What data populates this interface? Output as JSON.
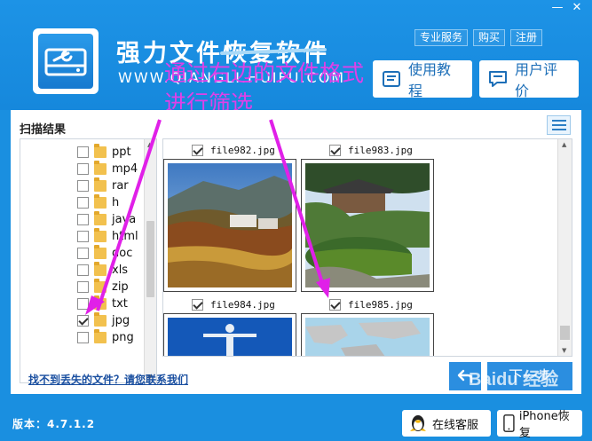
{
  "window": {
    "controls": [
      "—",
      "✕"
    ],
    "title": "强力文件恢复软件",
    "url": "WWW.QIANGLI.HUIFU.COM"
  },
  "header": {
    "links": [
      "专业服务",
      "购买",
      "注册"
    ],
    "tutorial_label": "使用教程",
    "review_label": "用户评价"
  },
  "annotation": {
    "line1": "通过右边的文件格式",
    "line2": "进行筛选"
  },
  "panel": {
    "title": "扫描结果",
    "tree": [
      {
        "label": "ppt",
        "checked": false
      },
      {
        "label": "mp4",
        "checked": false
      },
      {
        "label": "rar",
        "checked": false
      },
      {
        "label": "h",
        "checked": false
      },
      {
        "label": "java",
        "checked": false
      },
      {
        "label": "html",
        "checked": false
      },
      {
        "label": "doc",
        "checked": false
      },
      {
        "label": "xls",
        "checked": false
      },
      {
        "label": "zip",
        "checked": false
      },
      {
        "label": "txt",
        "checked": false
      },
      {
        "label": "jpg",
        "checked": true
      },
      {
        "label": "png",
        "checked": false
      }
    ],
    "files": [
      {
        "name": "file982.jpg",
        "checked": true
      },
      {
        "name": "file983.jpg",
        "checked": true
      },
      {
        "name": "file984.jpg",
        "checked": true
      },
      {
        "name": "file985.jpg",
        "checked": true
      }
    ],
    "contact_link": "找不到丢失的文件？请您联系我们",
    "next_label": "下一步"
  },
  "footer": {
    "version": "版本：4.7.1.2",
    "online_service": "在线客服",
    "iphone_recovery": "iPhone恢复"
  },
  "watermark": "Baidu 经验"
}
